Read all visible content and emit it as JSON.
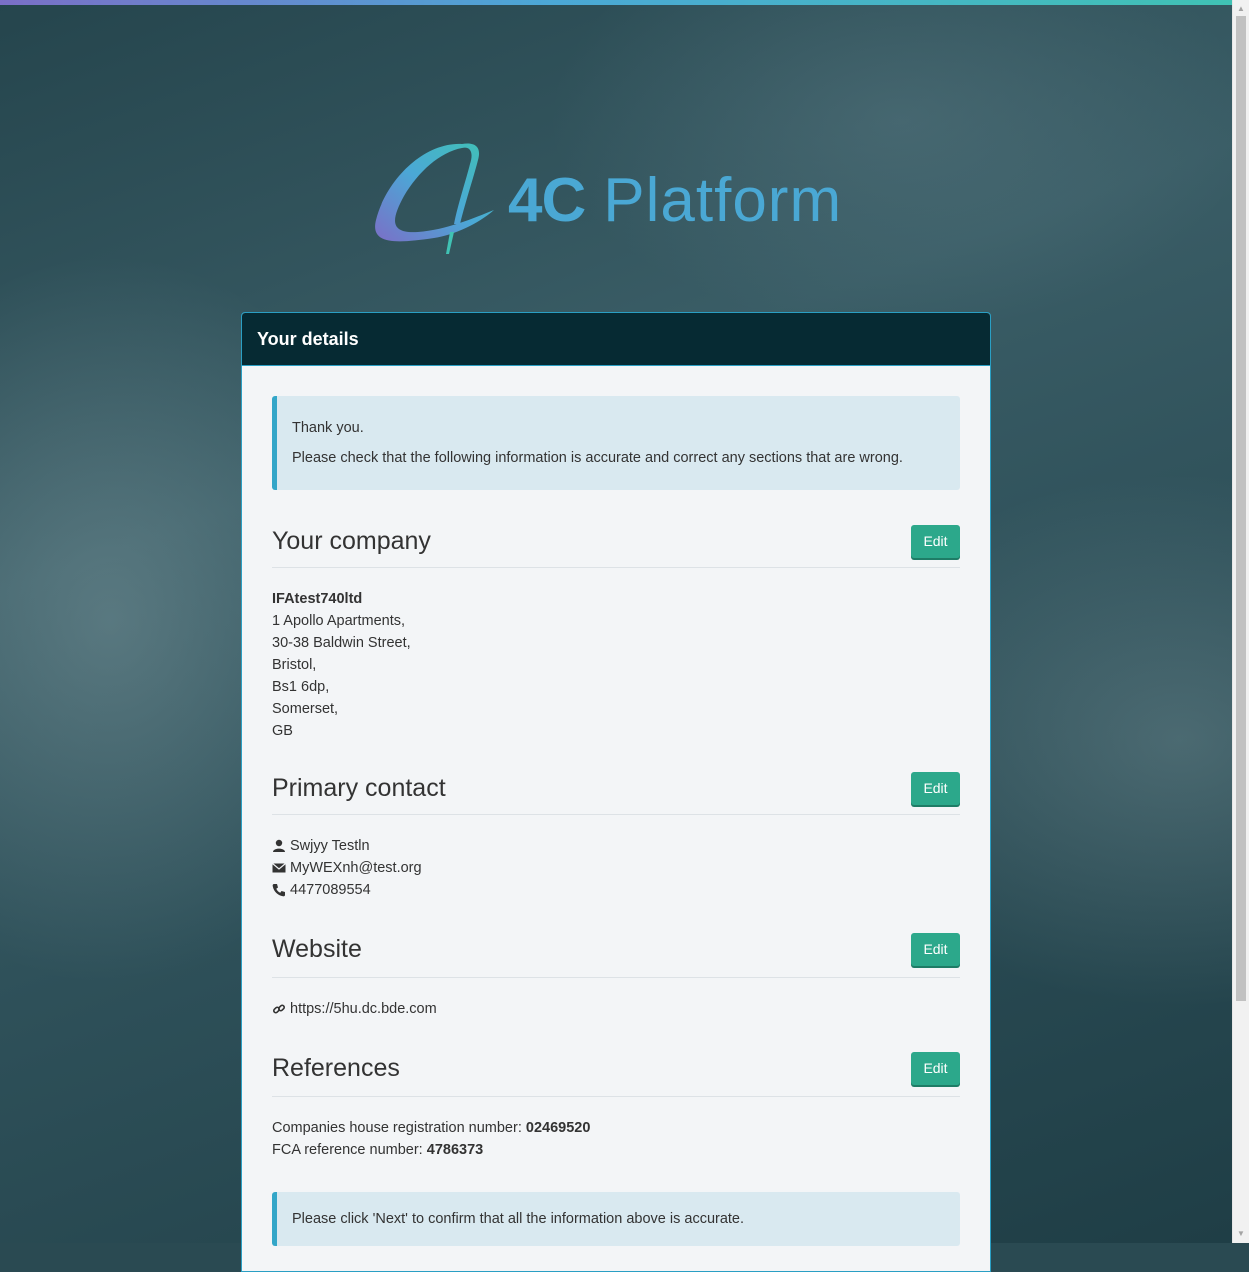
{
  "brand": {
    "mark": "4C",
    "name": "Platform",
    "accent": "#4aa8d4",
    "mark_gradient": [
      "#7b6fc7",
      "#4ba8d6",
      "#40c2b4"
    ]
  },
  "panel": {
    "title": "Your details"
  },
  "intro": {
    "line1": "Thank you.",
    "line2": "Please check that the following information is accurate and correct any sections that are wrong."
  },
  "company": {
    "title": "Your company",
    "edit_label": "Edit",
    "name": "IFAtest740ltd",
    "address": [
      "1 Apollo Apartments,",
      "30-38 Baldwin Street,",
      "Bristol,",
      "Bs1 6dp,",
      "Somerset,",
      "GB"
    ]
  },
  "contact": {
    "title": "Primary contact",
    "edit_label": "Edit",
    "name": "Swjyy Testln",
    "email": "MyWEXnh@test.org",
    "phone": "4477089554",
    "icons": [
      "user-icon",
      "envelope-icon",
      "phone-icon"
    ]
  },
  "website": {
    "title": "Website",
    "edit_label": "Edit",
    "url": "https://5hu.dc.bde.com",
    "icon": "link-icon"
  },
  "references": {
    "title": "References",
    "edit_label": "Edit",
    "companies_house_label": "Companies house registration number:",
    "companies_house_value": "02469520",
    "fca_label": "FCA reference number:",
    "fca_value": "4786373"
  },
  "confirm": {
    "text": "Please click 'Next' to confirm that all the information above is accurate."
  },
  "colors": {
    "panel_header": "#062a33",
    "button": "#2ca88b",
    "alert_bg": "#d9e9f0",
    "alert_border": "#33a6c8"
  }
}
